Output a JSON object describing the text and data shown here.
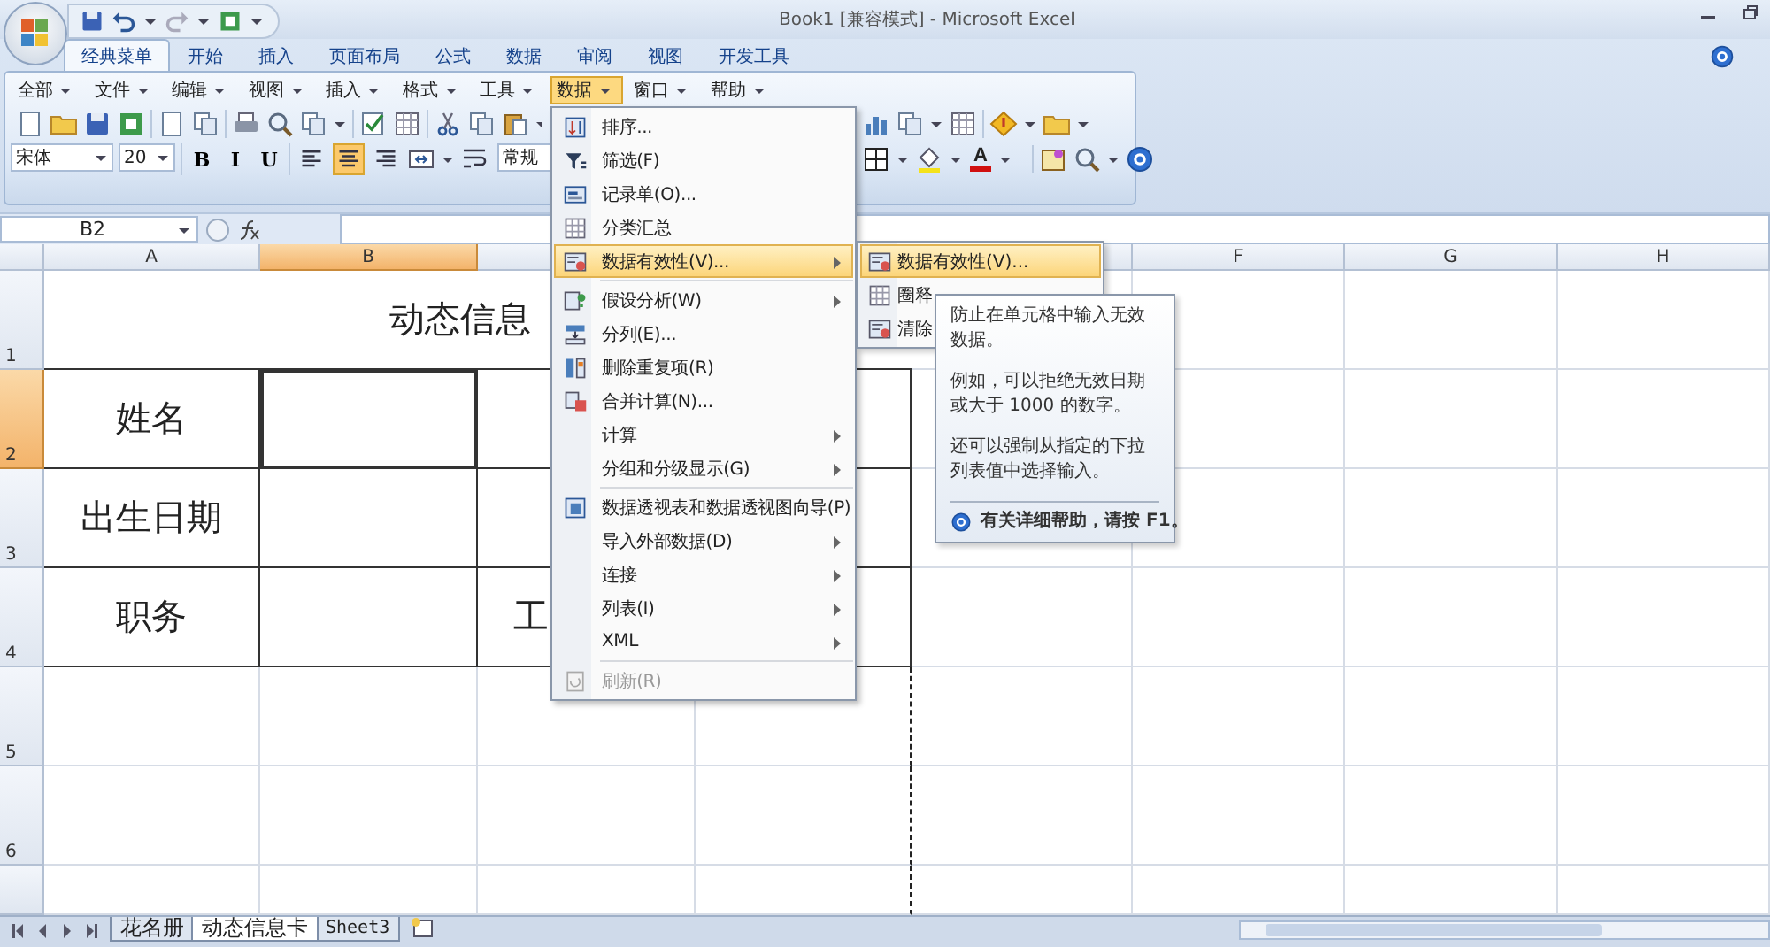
{
  "title_bar": {
    "title": "Book1  [兼容模式] - Microsoft Excel"
  },
  "ribbon_tabs": [
    {
      "label": "经典菜单",
      "selected": true
    },
    {
      "label": "开始",
      "selected": false
    },
    {
      "label": "插入",
      "selected": false
    },
    {
      "label": "页面布局",
      "selected": false
    },
    {
      "label": "公式",
      "selected": false
    },
    {
      "label": "数据",
      "selected": false
    },
    {
      "label": "审阅",
      "selected": false
    },
    {
      "label": "视图",
      "selected": false
    },
    {
      "label": "开发工具",
      "selected": false
    }
  ],
  "classic_menu": [
    {
      "label": "全部",
      "selected": false
    },
    {
      "label": "文件",
      "selected": false
    },
    {
      "label": "编辑",
      "selected": false
    },
    {
      "label": "视图",
      "selected": false
    },
    {
      "label": "插入",
      "selected": false
    },
    {
      "label": "格式",
      "selected": false
    },
    {
      "label": "工具",
      "selected": false
    },
    {
      "label": "数据",
      "selected": true
    },
    {
      "label": "窗口",
      "selected": false
    },
    {
      "label": "帮助",
      "selected": false
    }
  ],
  "formatting": {
    "font": "宋体",
    "size": "20",
    "styles": [
      "B",
      "I",
      "U"
    ],
    "alignment": [
      {
        "selected": false
      },
      {
        "selected": true
      },
      {
        "selected": false
      }
    ],
    "number_format": "常规",
    "font_color_label": "A"
  },
  "formula_bar": {
    "name_box": "B2"
  },
  "sheet": {
    "columns": [
      {
        "label": "A",
        "selected": false
      },
      {
        "label": "B",
        "selected": true
      },
      {
        "selected": false
      },
      {},
      {
        "selected": false
      },
      {
        "label": "F",
        "selected": false
      },
      {
        "label": "G",
        "selected": false
      },
      {
        "label": "H",
        "selected": false
      }
    ],
    "rows": [
      {
        "label": "1",
        "selected": false,
        "boxed": true,
        "cells": [
          {
            "text": "动态信息",
            "merged": true,
            "kind": "partial",
            "selected": false
          },
          {
            "selected": false
          },
          {
            "selected": false
          },
          {
            "selected": false
          },
          {
            "selected": false
          }
        ]
      },
      {
        "label": "2",
        "selected": true,
        "boxed": true,
        "cells": [
          {
            "text": "姓名",
            "selected": false
          },
          {
            "selected": true
          },
          {
            "selected": false
          },
          {
            "selected": false
          },
          {
            "selected": false
          },
          {
            "selected": false
          },
          {
            "selected": false
          },
          {
            "selected": false
          }
        ]
      },
      {
        "label": "3",
        "selected": false,
        "boxed": true,
        "cells": [
          {
            "text": "出生日期",
            "selected": false
          },
          {
            "selected": false
          },
          {
            "selected": false
          },
          {
            "selected": false
          },
          {
            "selected": false
          },
          {
            "selected": false
          },
          {
            "selected": false
          },
          {
            "selected": false
          }
        ]
      },
      {
        "label": "4",
        "selected": false,
        "boxed": true,
        "cells": [
          {
            "text": "职务",
            "selected": false
          },
          {
            "selected": false
          },
          {
            "text": "工",
            "kind": "partial",
            "selected": false
          },
          {
            "selected": false
          },
          {
            "selected": false
          },
          {
            "selected": false
          },
          {
            "selected": false
          },
          {
            "selected": false
          }
        ]
      },
      {
        "label": "5",
        "selected": false,
        "boxed": false,
        "cells": [
          {
            "selected": false
          },
          {
            "selected": false
          },
          {
            "selected": false
          },
          {
            "selected": false
          },
          {
            "selected": false
          },
          {
            "selected": false
          },
          {
            "selected": false
          },
          {
            "selected": false
          }
        ]
      },
      {
        "label": "6",
        "selected": false,
        "boxed": false,
        "cells": [
          {
            "selected": false
          },
          {
            "selected": false
          },
          {
            "selected": false
          },
          {
            "selected": false
          },
          {
            "selected": false
          },
          {
            "selected": false
          },
          {
            "selected": false
          },
          {
            "selected": false
          }
        ]
      }
    ]
  },
  "data_menu": {
    "items": [
      {
        "label": "排序...",
        "kind": "icon",
        "submenu": false,
        "selected": false,
        "disabled": false,
        "separator_before": false
      },
      {
        "label": "筛选(F)",
        "kind": "icon",
        "submenu": false,
        "selected": false,
        "disabled": false,
        "separator_before": false
      },
      {
        "label": "记录单(O)...",
        "kind": "icon",
        "submenu": false,
        "selected": false,
        "disabled": false,
        "separator_before": false
      },
      {
        "label": "分类汇总",
        "kind": "icon",
        "submenu": false,
        "selected": false,
        "disabled": false,
        "separator_before": false
      },
      {
        "label": "数据有效性(V)...",
        "kind": "icon",
        "submenu": true,
        "selected": true,
        "disabled": false,
        "separator_before": false
      },
      {
        "label": "假设分析(W)",
        "kind": "icon",
        "submenu": true,
        "selected": false,
        "disabled": false,
        "separator_before": true
      },
      {
        "label": "分列(E)...",
        "kind": "icon",
        "submenu": false,
        "selected": false,
        "disabled": false,
        "separator_before": false
      },
      {
        "label": "删除重复项(R)",
        "kind": "icon",
        "submenu": false,
        "selected": false,
        "disabled": false,
        "separator_before": false
      },
      {
        "label": "合并计算(N)...",
        "kind": "icon",
        "submenu": false,
        "selected": false,
        "disabled": false,
        "separator_before": false
      },
      {
        "label": "计算",
        "kind": "text",
        "submenu": true,
        "selected": false,
        "disabled": false,
        "separator_before": false
      },
      {
        "label": "分组和分级显示(G)",
        "kind": "text",
        "submenu": true,
        "selected": false,
        "disabled": false,
        "separator_before": false
      },
      {
        "label": "数据透视表和数据透视图向导(P)",
        "kind": "icon",
        "submenu": false,
        "selected": false,
        "disabled": false,
        "separator_before": true
      },
      {
        "label": "导入外部数据(D)",
        "kind": "text",
        "submenu": true,
        "selected": false,
        "disabled": false,
        "separator_before": false
      },
      {
        "label": "连接",
        "kind": "text",
        "submenu": true,
        "selected": false,
        "disabled": false,
        "separator_before": false
      },
      {
        "label": "列表(I)",
        "kind": "text",
        "submenu": true,
        "selected": false,
        "disabled": false,
        "separator_before": false
      },
      {
        "label": "XML",
        "kind": "text",
        "submenu": true,
        "selected": false,
        "disabled": false,
        "separator_before": false
      },
      {
        "label": "刷新(R)",
        "kind": "icon",
        "submenu": false,
        "selected": false,
        "disabled": true,
        "separator_before": true
      }
    ]
  },
  "submenu": {
    "items": [
      {
        "label": "数据有效性(V)...",
        "selected": true
      },
      {
        "label": "圈释",
        "selected": false
      },
      {
        "label": "清除",
        "selected": false
      }
    ]
  },
  "tooltip": {
    "paragraphs": [
      "防止在单元格中输入无效数据。",
      "例如，可以拒绝无效日期或大于 1000 的数字。",
      "还可以强制从指定的下拉列表值中选择输入。"
    ],
    "help": "有关详细帮助，请按 F1。"
  },
  "sheet_tabs": [
    {
      "label": "花名册",
      "selected": false
    },
    {
      "label": "动态信息卡",
      "selected": true
    },
    {
      "label": "Sheet3",
      "selected": false
    }
  ]
}
